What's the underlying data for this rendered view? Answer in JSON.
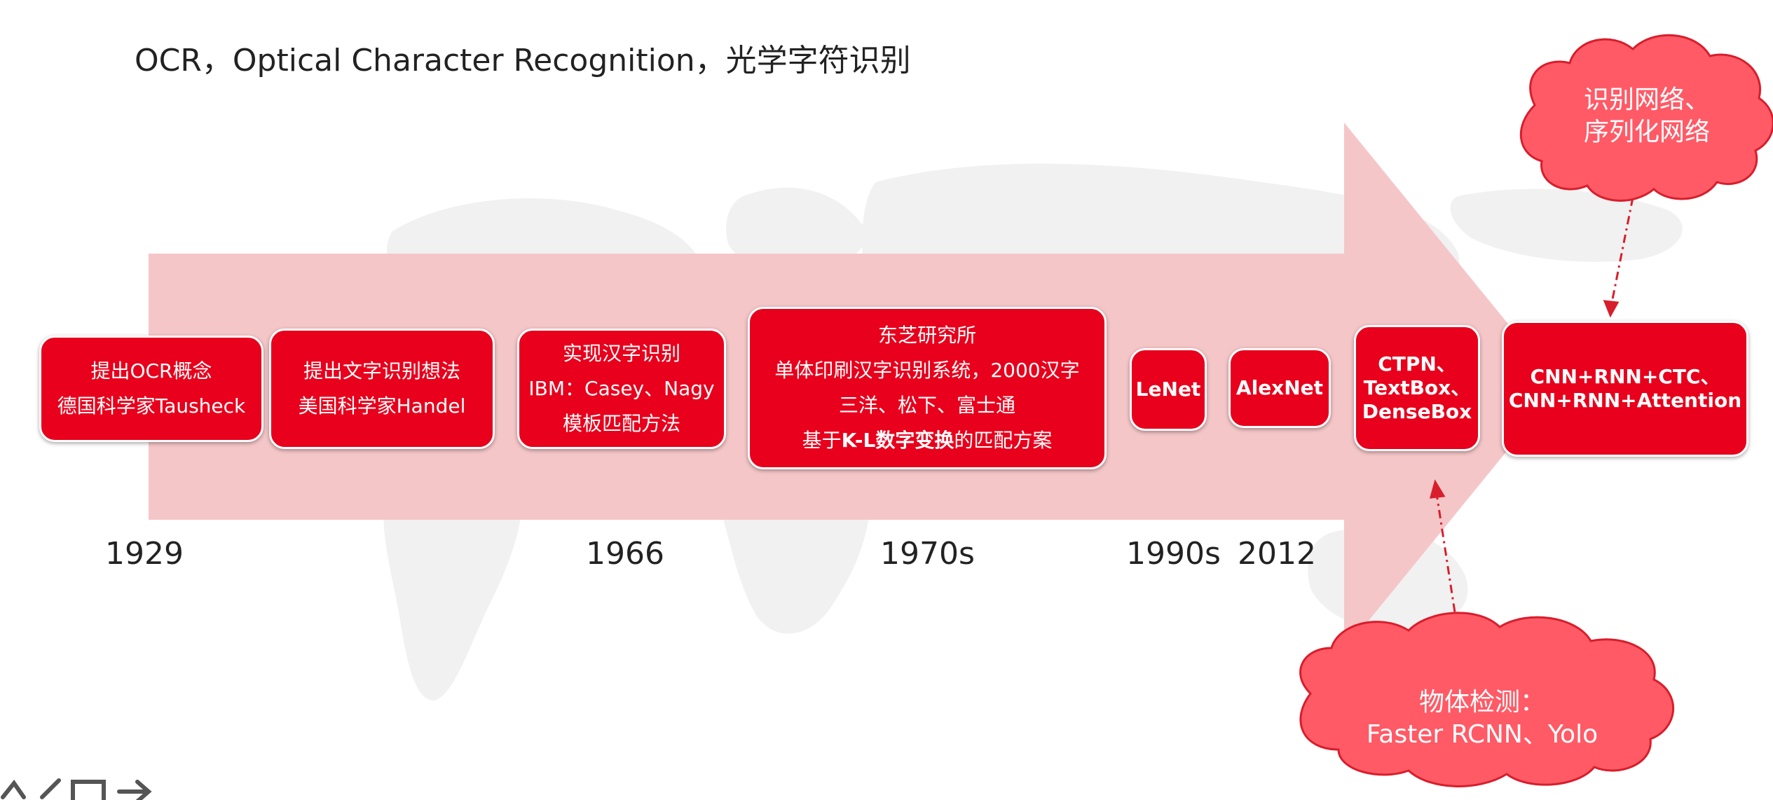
{
  "title": "OCR，Optical Character Recognition，光学字符识别",
  "colors": {
    "arrow": "#f5c6c8",
    "box": "#e8001c",
    "cloud": "#ff5a66",
    "cloud_border": "#d81e2c",
    "connector": "#d81e2c"
  },
  "milestones": [
    {
      "lines": [
        "提出OCR概念",
        "德国科学家Tausheck"
      ]
    },
    {
      "lines": [
        "提出文字识别想法",
        "美国科学家Handel"
      ]
    },
    {
      "lines": [
        "实现汉字识别",
        "IBM：Casey、Nagy",
        "模板匹配方法"
      ]
    },
    {
      "lines": [
        "东芝研究所",
        "单体印刷汉字识别系统，2000汉字",
        "三洋、松下、富士通",
        "基于K-L数字变换的匹配方案"
      ],
      "bold_phrase": "K-L数字变换"
    },
    {
      "lines": [
        "LeNet"
      ]
    },
    {
      "lines": [
        "AlexNet"
      ]
    },
    {
      "lines": [
        "CTPN、",
        "TextBox、",
        "DenseBox"
      ]
    },
    {
      "lines": [
        "CNN+RNN+CTC、",
        "CNN+RNN+Attention"
      ]
    }
  ],
  "years": [
    "1929",
    "1966",
    "1970s",
    "1990s",
    "2012"
  ],
  "clouds": {
    "top": {
      "lines": [
        "识别网络、",
        "序列化网络"
      ]
    },
    "bottom": {
      "lines": [
        "物体检测：",
        "Faster RCNN、Yolo"
      ]
    }
  },
  "icons": {
    "map_background": "world-map-watermark",
    "footer": "toolbar-partial-icon"
  }
}
